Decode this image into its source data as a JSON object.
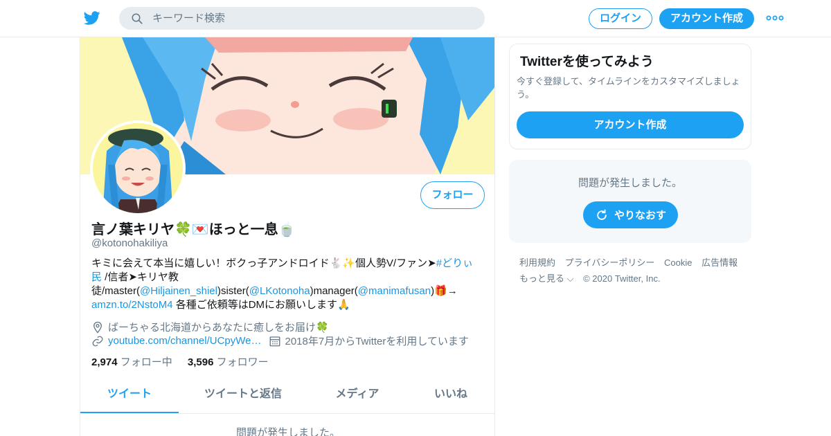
{
  "header": {
    "search_placeholder": "キーワード検索",
    "login_label": "ログイン",
    "signup_label": "アカウント作成"
  },
  "profile": {
    "name": "言ノ葉キリヤ🍀💌ほっと一息🍵",
    "handle": "@kotonohakiliya",
    "follow_label": "フォロー",
    "bio": {
      "t1": "キミに会えて本当に嬉しい！ボクっ子アンドロイド🐇✨個人勢V/ファン➤",
      "hashtag": "#どりぃ民",
      "t2": " /信者➤キリヤ教徒/master(",
      "m1": "@Hiljainen_shiel",
      "t3": ")sister(",
      "m2": "@LKotonoha",
      "t4": ")manager(",
      "m3": "@manimafusan",
      "t5": ")🎁→",
      "link": "amzn.to/2NstoM4",
      "t6": " 各種ご依頼等はDMにお願いします🙏"
    },
    "location": "ばーちゃる北海道からあなたに癒しをお届け🍀",
    "url": "youtube.com/channel/UCpyWe…",
    "joined": "2018年7月からTwitterを利用しています",
    "following_count": "2,974",
    "following_label": "フォロー中",
    "followers_count": "3,596",
    "followers_label": "フォロワー"
  },
  "tabs": [
    {
      "label": "ツイート"
    },
    {
      "label": "ツイートと返信"
    },
    {
      "label": "メディア"
    },
    {
      "label": "いいね"
    }
  ],
  "timeline_error": "問題が発生しました。",
  "sidebar": {
    "signup_card": {
      "title": "Twitterを使ってみよう",
      "text": "今すぐ登録して、タイムラインをカスタマイズしましょう。",
      "button": "アカウント作成"
    },
    "error_card": {
      "message": "問題が発生しました。",
      "retry": "やりなおす"
    }
  },
  "footer": {
    "links": [
      "利用規約",
      "プライバシーポリシー",
      "Cookie",
      "広告情報",
      "もっと見る ⌵"
    ],
    "copyright": "© 2020 Twitter, Inc."
  },
  "colors": {
    "accent": "#1da1f2",
    "link": "#1b95e0",
    "muted": "#657786",
    "banner_bg": "#fdf7b6"
  }
}
